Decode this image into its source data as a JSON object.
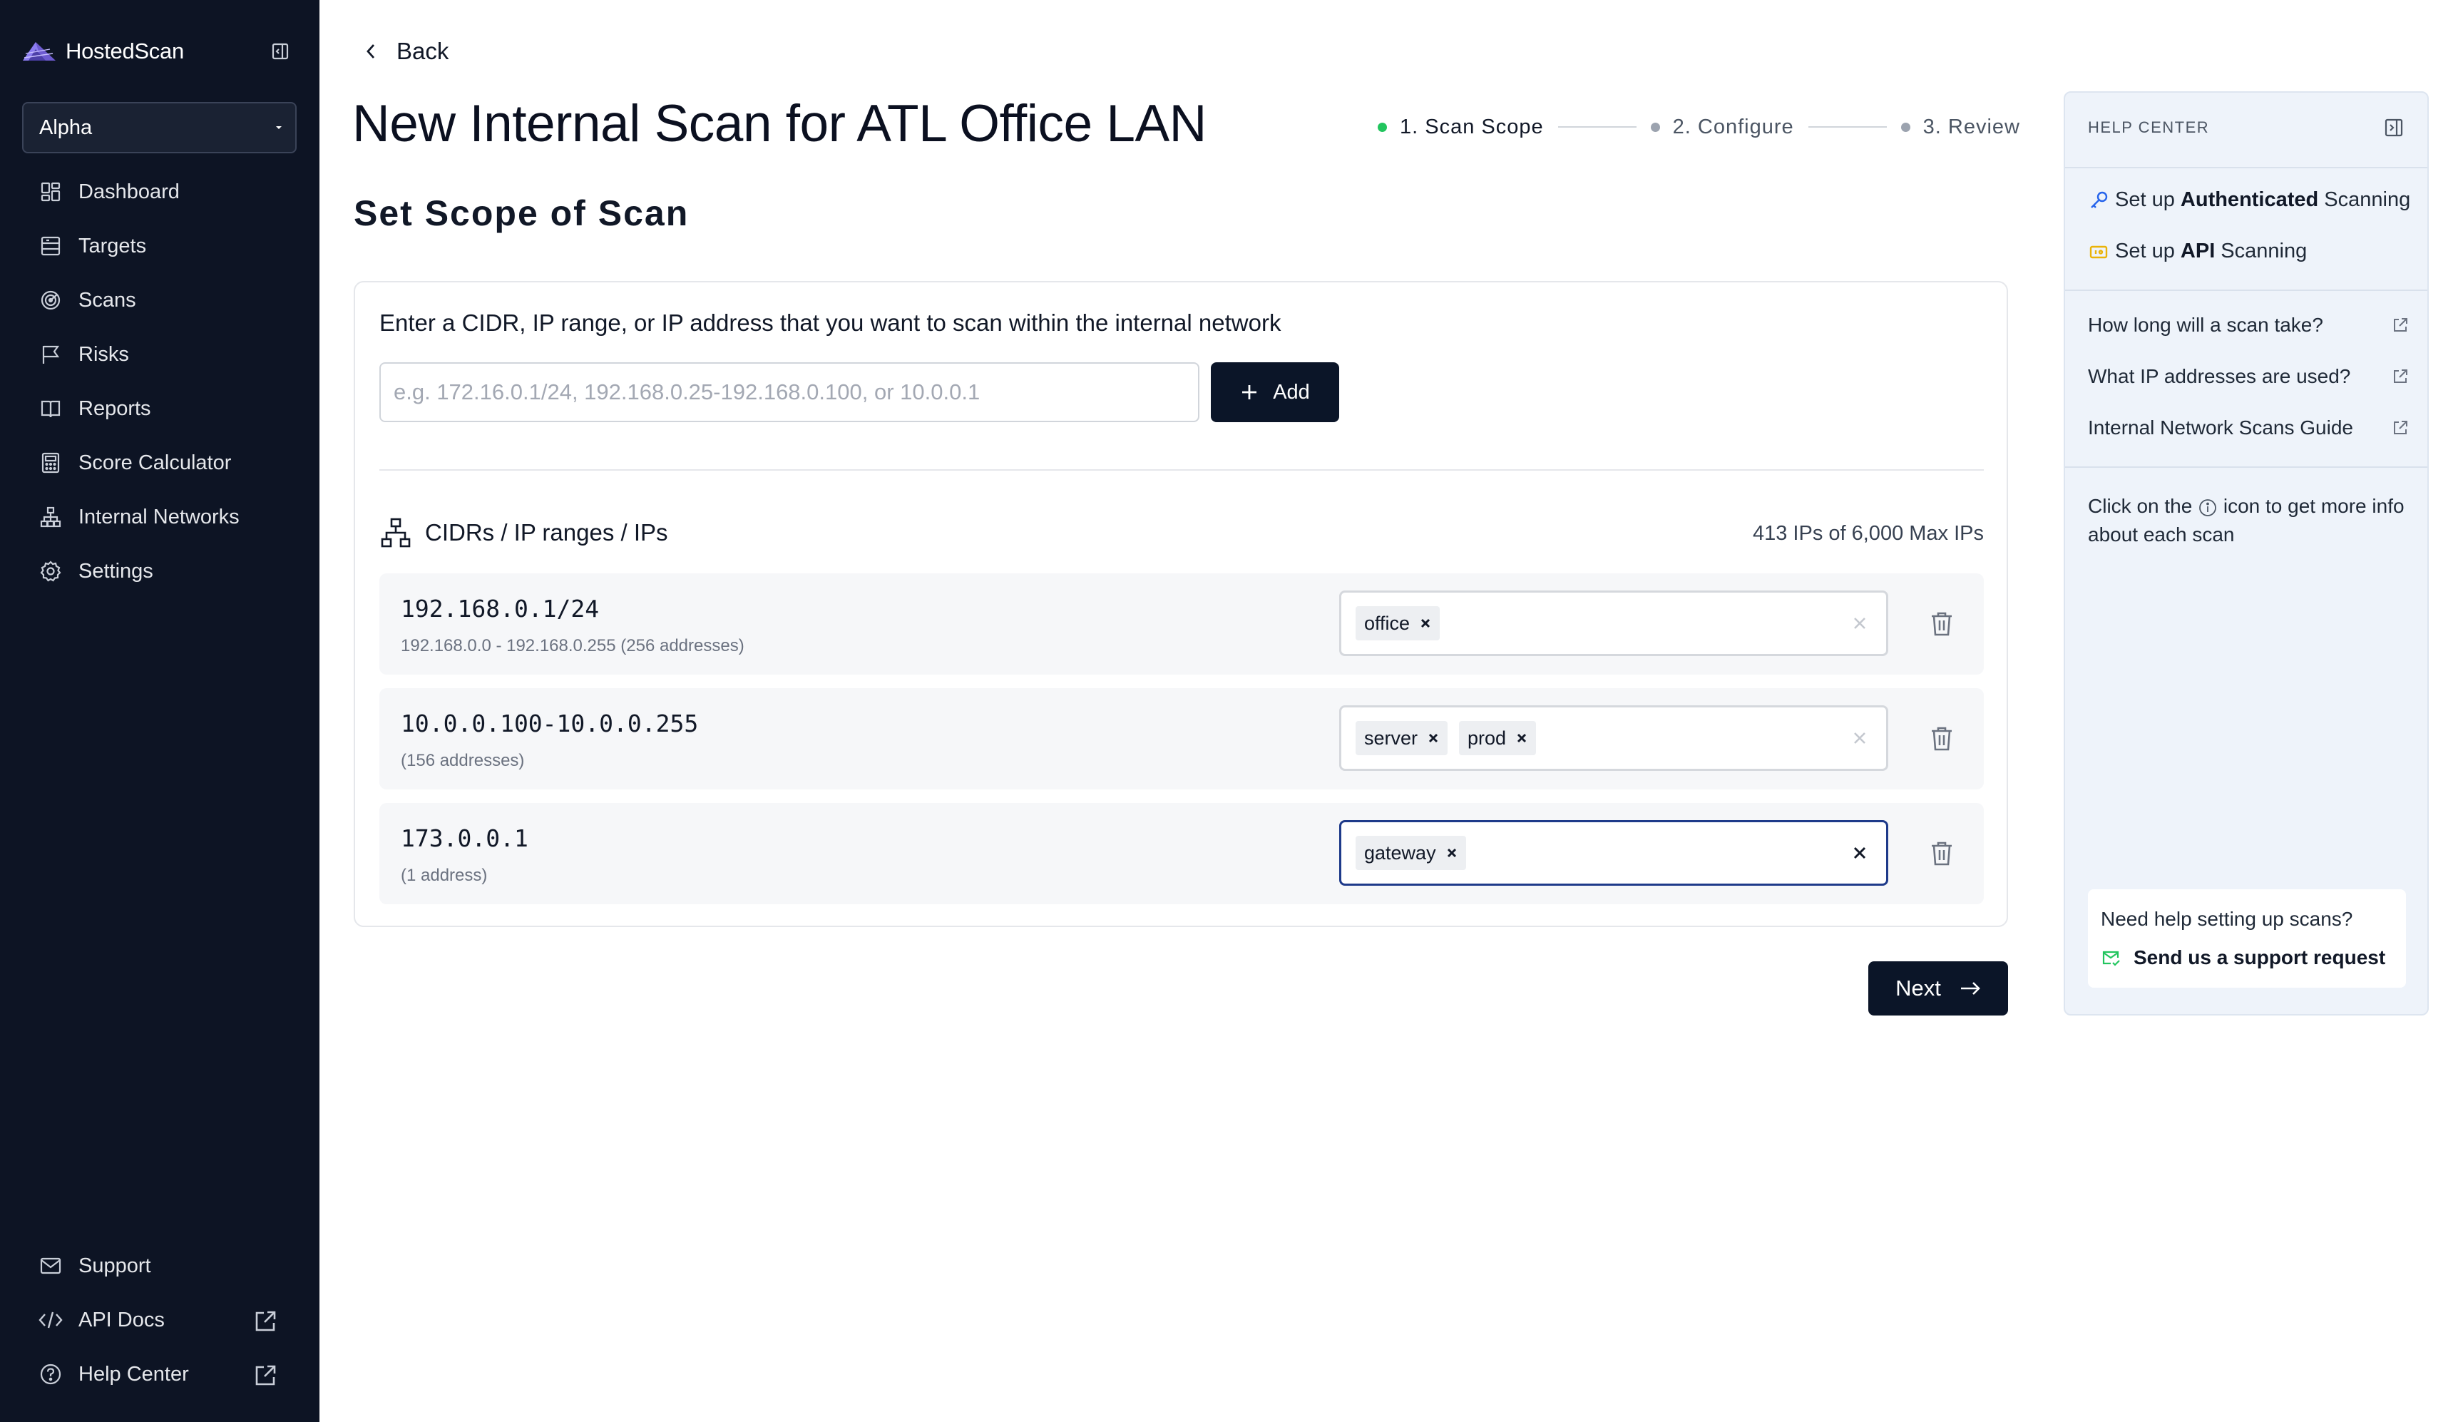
{
  "sidebar": {
    "brand": "HostedScan",
    "org_select": "Alpha",
    "nav_top": [
      {
        "label": "Dashboard",
        "icon": "dashboard-icon"
      },
      {
        "label": "Targets",
        "icon": "targets-icon"
      },
      {
        "label": "Scans",
        "icon": "scans-icon"
      },
      {
        "label": "Risks",
        "icon": "flag-icon"
      },
      {
        "label": "Reports",
        "icon": "book-icon"
      },
      {
        "label": "Score Calculator",
        "icon": "calculator-icon"
      },
      {
        "label": "Internal Networks",
        "icon": "network-icon"
      },
      {
        "label": "Settings",
        "icon": "gear-icon"
      }
    ],
    "nav_bottom": [
      {
        "label": "Support",
        "icon": "mail-icon"
      },
      {
        "label": "API Docs",
        "icon": "code-icon"
      },
      {
        "label": "Help Center",
        "icon": "question-icon"
      }
    ]
  },
  "main": {
    "back_label": "Back",
    "page_title": "New Internal Scan for ATL Office LAN",
    "steps": [
      {
        "label": "1. Scan Scope",
        "state": "active"
      },
      {
        "label": "2. Configure",
        "state": "pending"
      },
      {
        "label": "3. Review",
        "state": "pending"
      }
    ],
    "section_title": "Set Scope of Scan",
    "instruction": "Enter a CIDR, IP range, or IP address that you want to scan within the internal network",
    "input_placeholder": "e.g. 172.16.0.1/24, 192.168.0.25-192.168.0.100, or 10.0.0.1",
    "input_value": "",
    "add_label": "Add",
    "list_header": "CIDRs / IP ranges / IPs",
    "ip_count": "413 IPs of 6,000 Max IPs",
    "rows": [
      {
        "target": "192.168.0.1/24",
        "detail": "192.168.0.0 - 192.168.0.255 (256 addresses)",
        "tags": [
          "office"
        ],
        "focused": false
      },
      {
        "target": "10.0.0.100-10.0.0.255",
        "detail": "(156 addresses)",
        "tags": [
          "server",
          "prod"
        ],
        "focused": false
      },
      {
        "target": "173.0.0.1",
        "detail": "(1 address)",
        "tags": [
          "gateway"
        ],
        "focused": true
      }
    ],
    "next_label": "Next"
  },
  "help": {
    "header": "HELP CENTER",
    "guides": [
      {
        "pre": "Set up ",
        "bold": "Authenticated",
        "post": " Scanning",
        "icon": "key-icon"
      },
      {
        "pre": "Set up ",
        "bold": "API",
        "post": " Scanning",
        "icon": "api-icon"
      }
    ],
    "faqs": [
      "How long will a scan take?",
      "What IP addresses are used?",
      "Internal Network Scans Guide"
    ],
    "note_pre": "Click on the",
    "note_post": "icon to get more info about each scan",
    "support_question": "Need help setting up scans?",
    "support_link": "Send us a support request"
  },
  "colors": {
    "sidebar_bg": "#0d1424",
    "primary_button": "#0b1528",
    "active_step": "#22c55e",
    "pending_step": "#9ca3af",
    "help_bg": "#eef3fa"
  }
}
